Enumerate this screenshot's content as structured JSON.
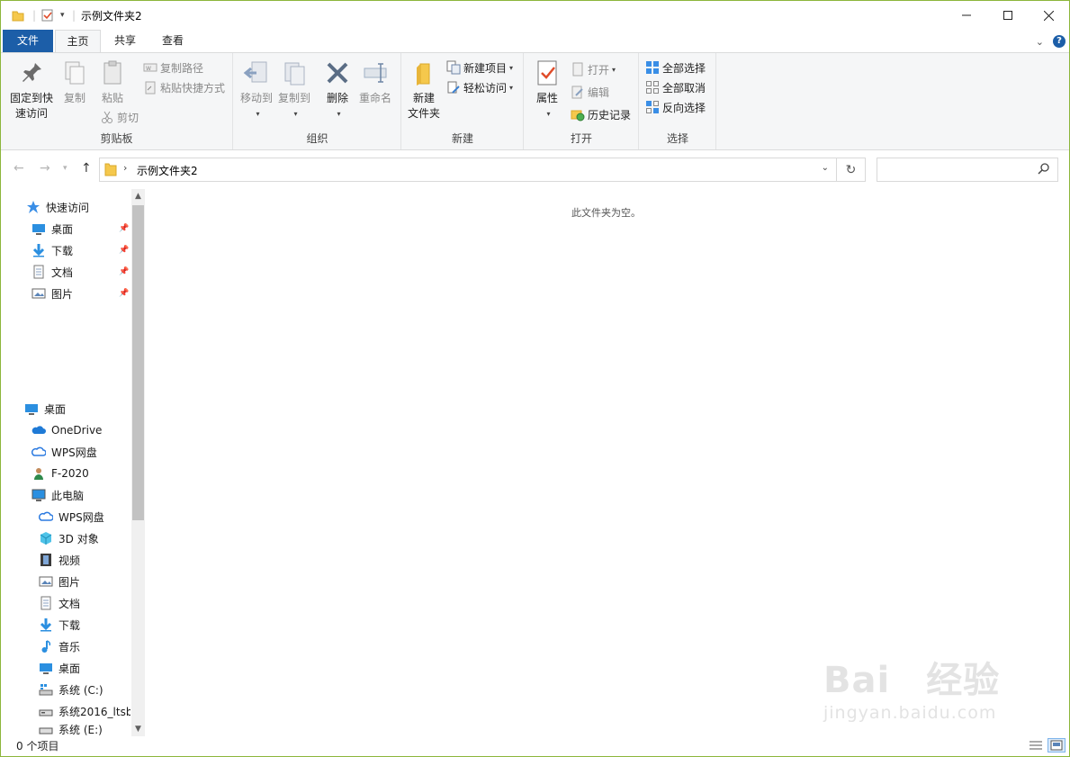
{
  "window": {
    "title": "示例文件夹2"
  },
  "tabs": {
    "file": "文件",
    "home": "主页",
    "share": "共享",
    "view": "查看"
  },
  "ribbon": {
    "clipboard": {
      "label": "剪贴板",
      "pin": "固定到快\n速访问",
      "copy": "复制",
      "paste": "粘贴",
      "copy_path": "复制路径",
      "paste_shortcut": "粘贴快捷方式",
      "cut": "剪切"
    },
    "organize": {
      "label": "组织",
      "move_to": "移动到",
      "copy_to": "复制到",
      "delete": "删除",
      "rename": "重命名"
    },
    "new": {
      "label": "新建",
      "new_folder": "新建\n文件夹",
      "new_item": "新建项目",
      "easy_access": "轻松访问"
    },
    "open": {
      "label": "打开",
      "properties": "属性",
      "open": "打开",
      "edit": "编辑",
      "history": "历史记录"
    },
    "select": {
      "label": "选择",
      "select_all": "全部选择",
      "select_none": "全部取消",
      "invert": "反向选择"
    }
  },
  "address": {
    "path": "示例文件夹2",
    "search_placeholder": ""
  },
  "nav": {
    "quick_access": "快速访问",
    "quick_items": [
      "桌面",
      "下载",
      "文档",
      "图片"
    ],
    "tree": [
      "桌面",
      "OneDrive",
      "WPS网盘",
      "F-2020",
      "此电脑"
    ],
    "pc_items": [
      "WPS网盘",
      "3D 对象",
      "视频",
      "图片",
      "文档",
      "下载",
      "音乐",
      "桌面",
      "系统 (C:)",
      "系统2016_ltsb",
      "系统 (E:)"
    ]
  },
  "content": {
    "empty_message": "此文件夹为空。"
  },
  "status": {
    "item_count": "0 个项目"
  },
  "watermark": {
    "main": "Bai经验",
    "sub": "jingyan.baidu.com"
  },
  "colors": {
    "accent": "#1c5ea8",
    "border": "#8cb63c",
    "folder": "#f5c84c"
  }
}
